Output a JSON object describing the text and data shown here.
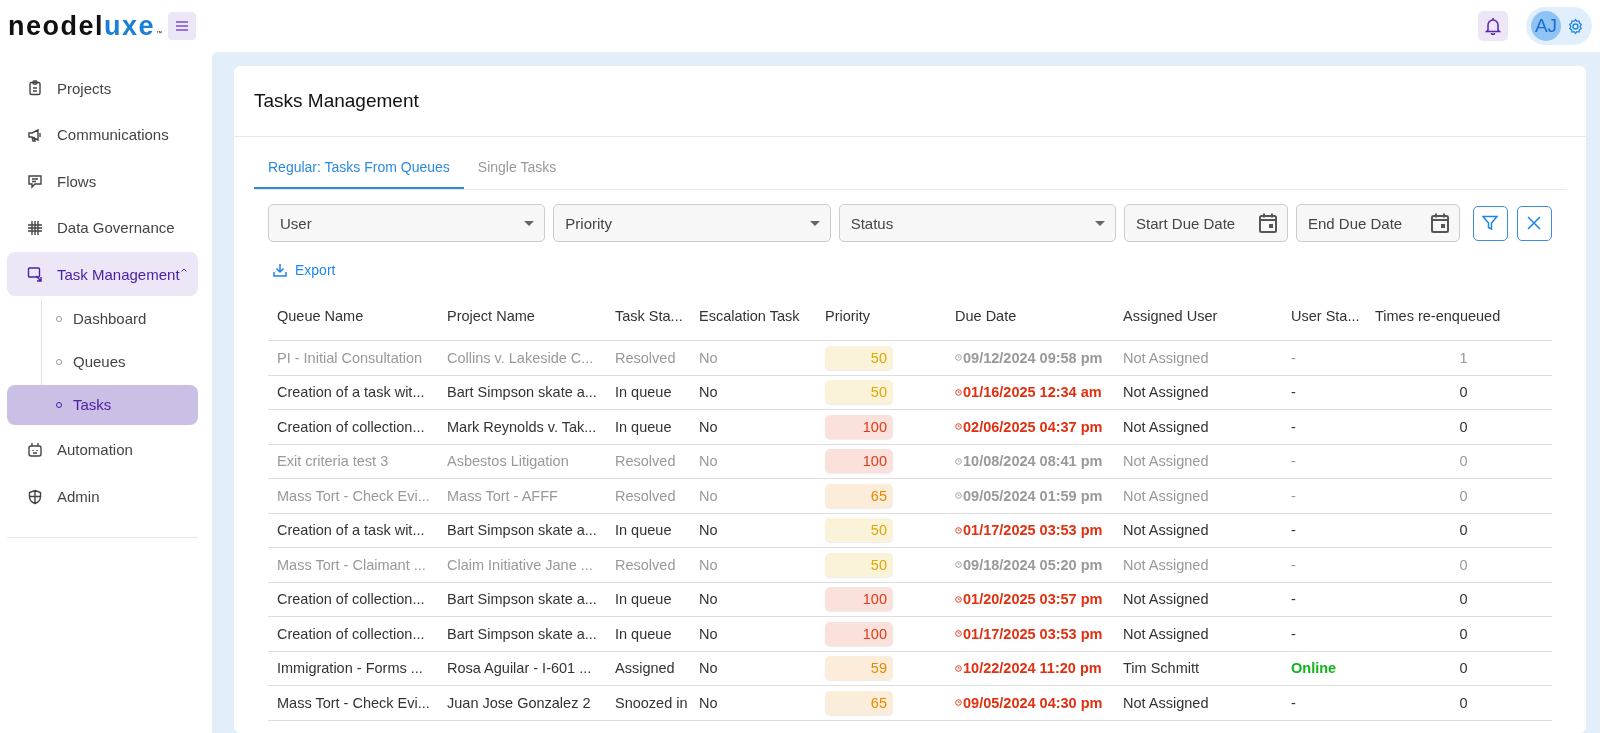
{
  "header": {
    "logo_dark": "neodel",
    "logo_accent": "uxe",
    "logo_mark": "™",
    "avatar": "AJ"
  },
  "sidebar": {
    "items": [
      {
        "label": "Projects",
        "selected": false
      },
      {
        "label": "Communications",
        "selected": false
      },
      {
        "label": "Flows",
        "selected": false
      },
      {
        "label": "Data Governance",
        "selected": false
      },
      {
        "label": "Task Management",
        "selected": true,
        "expanded": true,
        "children": [
          {
            "label": "Dashboard",
            "selected": false
          },
          {
            "label": "Queues",
            "selected": false
          },
          {
            "label": "Tasks",
            "selected": true
          }
        ]
      },
      {
        "label": "Automation",
        "selected": false
      },
      {
        "label": "Admin",
        "selected": false
      }
    ]
  },
  "page": {
    "title": "Tasks Management",
    "tabs": [
      {
        "label": "Regular: Tasks From Queues",
        "selected": true
      },
      {
        "label": "Single Tasks",
        "selected": false
      }
    ],
    "filters": [
      {
        "kind": "select",
        "placeholder": "User"
      },
      {
        "kind": "select",
        "placeholder": "Priority"
      },
      {
        "kind": "select",
        "placeholder": "Status"
      },
      {
        "kind": "date",
        "placeholder": "Start Due Date"
      },
      {
        "kind": "date",
        "placeholder": "End Due Date"
      }
    ],
    "export": "Export",
    "table": {
      "columns": [
        "Queue Name",
        "Project Name",
        "Task Sta...",
        "Escalation Task",
        "Priority",
        "Due Date",
        "Assigned User",
        "User Sta...",
        "Times re-enqueued"
      ],
      "rows": [
        {
          "resolved": true,
          "overdue": false,
          "color": "#e0a800",
          "online": false,
          "cells": [
            "PI - Initial Consultation",
            "Collins v. Lakeside C...",
            "Resolved",
            "No",
            "50",
            "09/12/2024 09:58 pm",
            "Not Assigned",
            "-",
            "1"
          ]
        },
        {
          "resolved": false,
          "overdue": true,
          "color": "#e0a800",
          "online": false,
          "cells": [
            "Creation of a task wit...",
            "Bart Simpson skate a...",
            "In queue",
            "No",
            "50",
            "01/16/2025 12:34 am",
            "Not Assigned",
            "-",
            "0"
          ]
        },
        {
          "resolved": false,
          "overdue": true,
          "color": "#e23a17",
          "online": false,
          "cells": [
            "Creation of collection...",
            "Mark Reynolds v. Tak...",
            "In queue",
            "No",
            "100",
            "02/06/2025 04:37 pm",
            "Not Assigned",
            "-",
            "0"
          ]
        },
        {
          "resolved": true,
          "overdue": false,
          "color": "#e23a17",
          "online": false,
          "cells": [
            "Exit criteria test 3",
            "Asbestos Litigation",
            "Resolved",
            "No",
            "100",
            "10/08/2024 08:41 pm",
            "Not Assigned",
            "-",
            "0"
          ]
        },
        {
          "resolved": true,
          "overdue": false,
          "color": "#e68a00",
          "online": false,
          "cells": [
            "Mass Tort - Check Evi...",
            "Mass Tort - AFFF",
            "Resolved",
            "No",
            "65",
            "09/05/2024 01:59 pm",
            "Not Assigned",
            "-",
            "0"
          ]
        },
        {
          "resolved": false,
          "overdue": true,
          "color": "#e0a800",
          "online": false,
          "cells": [
            "Creation of a task wit...",
            "Bart Simpson skate a...",
            "In queue",
            "No",
            "50",
            "01/17/2025 03:53 pm",
            "Not Assigned",
            "-",
            "0"
          ]
        },
        {
          "resolved": true,
          "overdue": false,
          "color": "#e0a800",
          "online": false,
          "cells": [
            "Mass Tort - Claimant ...",
            "Claim Initiative Jane ...",
            "Resolved",
            "No",
            "50",
            "09/18/2024 05:20 pm",
            "Not Assigned",
            "-",
            "0"
          ]
        },
        {
          "resolved": false,
          "overdue": true,
          "color": "#e23a17",
          "online": false,
          "cells": [
            "Creation of collection...",
            "Bart Simpson skate a...",
            "In queue",
            "No",
            "100",
            "01/20/2025 03:57 pm",
            "Not Assigned",
            "-",
            "0"
          ]
        },
        {
          "resolved": false,
          "overdue": true,
          "color": "#e23a17",
          "online": false,
          "cells": [
            "Creation of collection...",
            "Bart Simpson skate a...",
            "In queue",
            "No",
            "100",
            "01/17/2025 03:53 pm",
            "Not Assigned",
            "-",
            "0"
          ]
        },
        {
          "resolved": false,
          "overdue": true,
          "color": "#e68a00",
          "online": true,
          "cells": [
            "Immigration - Forms ...",
            "Rosa Aguilar - I-601 ...",
            "Assigned",
            "No",
            "59",
            "10/22/2024 11:20 pm",
            "Tim Schmitt",
            "Online",
            "0"
          ]
        },
        {
          "resolved": false,
          "overdue": true,
          "color": "#e68a00",
          "online": false,
          "cells": [
            "Mass Tort - Check Evi...",
            "Juan Jose Gonzalez 2",
            "Snoozed in",
            "No",
            "65",
            "09/05/2024 04:30 pm",
            "Not Assigned",
            "-",
            "0"
          ]
        }
      ]
    }
  }
}
